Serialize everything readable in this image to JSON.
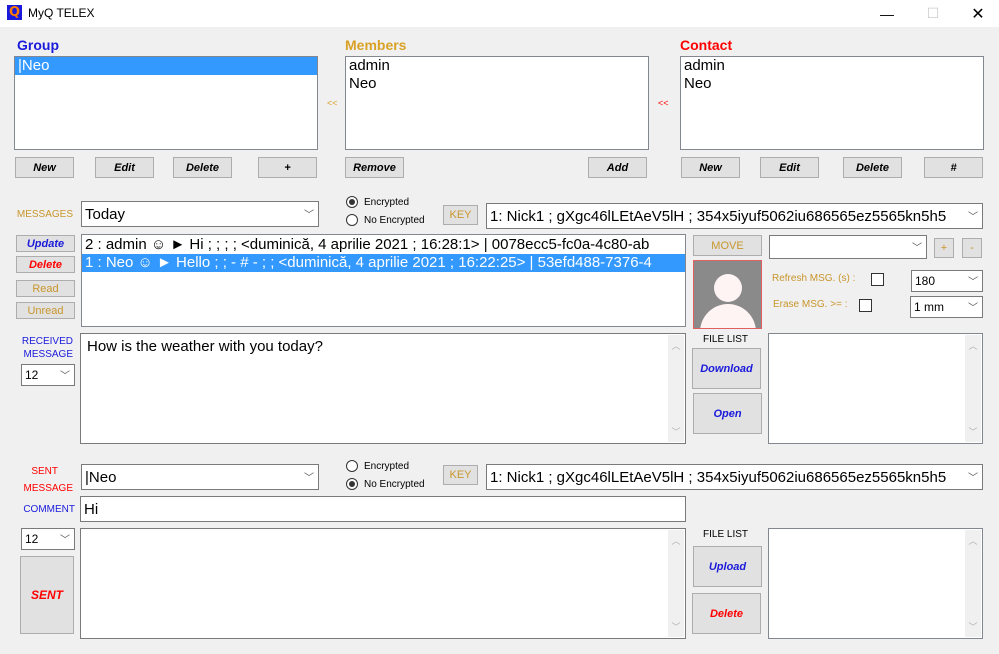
{
  "window": {
    "title": "MyQ TELEX",
    "app_icon": "Q",
    "minimize_icon": "—",
    "maximize_icon": "☐",
    "close_icon": "✕"
  },
  "colors": {
    "group_heading": "#1a1adb",
    "members_heading": "#d9a227",
    "contact_heading": "#ff0000",
    "selection": "#3399ff"
  },
  "group": {
    "heading": "Group",
    "items": [
      "|Neo"
    ],
    "selected_index": 0,
    "buttons": {
      "new": "New",
      "edit": "Edit",
      "delete": "Delete",
      "plus": "+"
    }
  },
  "transfer_arrows": {
    "to_group": "<<",
    "to_members": "<<"
  },
  "members": {
    "heading": "Members",
    "items": [
      "admin",
      "Neo"
    ],
    "buttons": {
      "remove": "Remove",
      "add": "Add"
    }
  },
  "contact": {
    "heading": "Contact",
    "items": [
      "admin",
      "Neo"
    ],
    "buttons": {
      "new": "New",
      "edit": "Edit",
      "delete": "Delete",
      "hash": "#"
    }
  },
  "messages": {
    "label": "MESSAGES",
    "filter_value": "Today",
    "encryption": {
      "encrypted": "Encrypted",
      "no_encrypted": "No Encrypted",
      "selected": "encrypted"
    },
    "key_button": "KEY",
    "key_value": "1: Nick1 ; gXgc46lLEtAeV5lH ; 354x5iyuf5062iu686565ez5565kn5h5",
    "side_buttons": {
      "update": "Update",
      "delete": "Delete",
      "read": "Read",
      "unread": "Unread"
    },
    "list": [
      "2 : admin ☺ ► Hi  ;  ;  ;  ; <duminică, 4 aprilie 2021 ; 16:28:1> | 0078ecc5-fc0a-4c80-ab",
      "1 : Neo ☺ ► Hello  ;  ; - # - ;  ; <duminică, 4 aprilie 2021 ; 16:22:25> | 53efd488-7376-4"
    ],
    "selected_index": 1,
    "move_button": "MOVE",
    "move_target_value": "",
    "plus_button": "+",
    "minus_button": "-",
    "refresh_label": "Refresh MSG. (s) :",
    "refresh_checked": false,
    "refresh_value": "180",
    "erase_label": "Erase MSG. >= :",
    "erase_checked": false,
    "erase_value": "1 mm"
  },
  "received": {
    "label_line1": "RECEIVED",
    "label_line2": "MESSAGE",
    "font_size_value": "12",
    "text": "How is the weather with you today?",
    "file_list_label": "FILE LIST",
    "download_button": "Download",
    "open_button": "Open"
  },
  "sent": {
    "label_line1": "SENT",
    "label_line2": "MESSAGE",
    "recipient_value": "|Neo",
    "encryption": {
      "encrypted": "Encrypted",
      "no_encrypted": "No Encrypted",
      "selected": "no_encrypted"
    },
    "key_button": "KEY",
    "key_value": "1: Nick1 ; gXgc46lLEtAeV5lH ; 354x5iyuf5062iu686565ez5565kn5h5",
    "comment_label": "COMMENT",
    "comment_value": "Hi",
    "font_size_value": "12",
    "body_text": "",
    "send_button": "SENT",
    "file_list_label": "FILE LIST",
    "upload_button": "Upload",
    "delete_button": "Delete"
  }
}
